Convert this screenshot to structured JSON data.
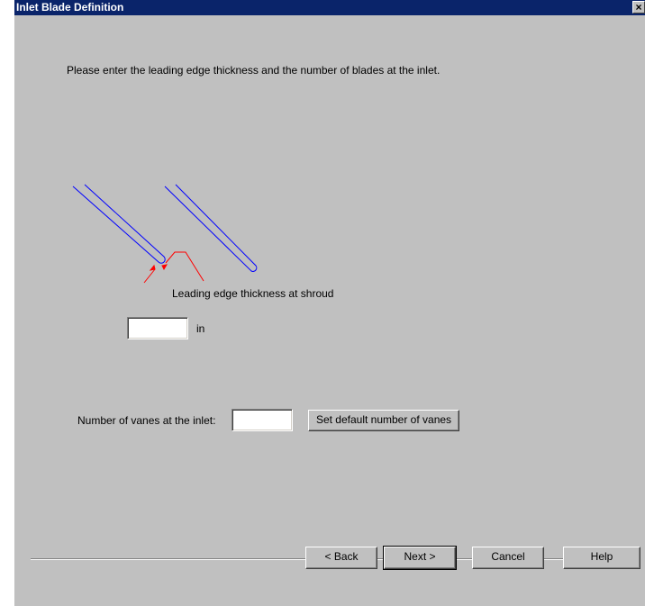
{
  "window": {
    "title": "Inlet Blade Definition",
    "close_glyph": "×"
  },
  "instructions": "Please enter the leading edge thickness and the number of blades at the inlet.",
  "diagram": {
    "label": "Leading edge thickness at shroud",
    "blade_color": "#0000ff",
    "dimension_color": "#ff0000"
  },
  "thickness": {
    "value": "",
    "unit": "in"
  },
  "vanes": {
    "label": "Number of vanes at the inlet:",
    "value": "",
    "default_button": "Set default number of vanes"
  },
  "buttons": {
    "back": "< Back",
    "next": "Next >",
    "cancel": "Cancel",
    "help": "Help"
  }
}
